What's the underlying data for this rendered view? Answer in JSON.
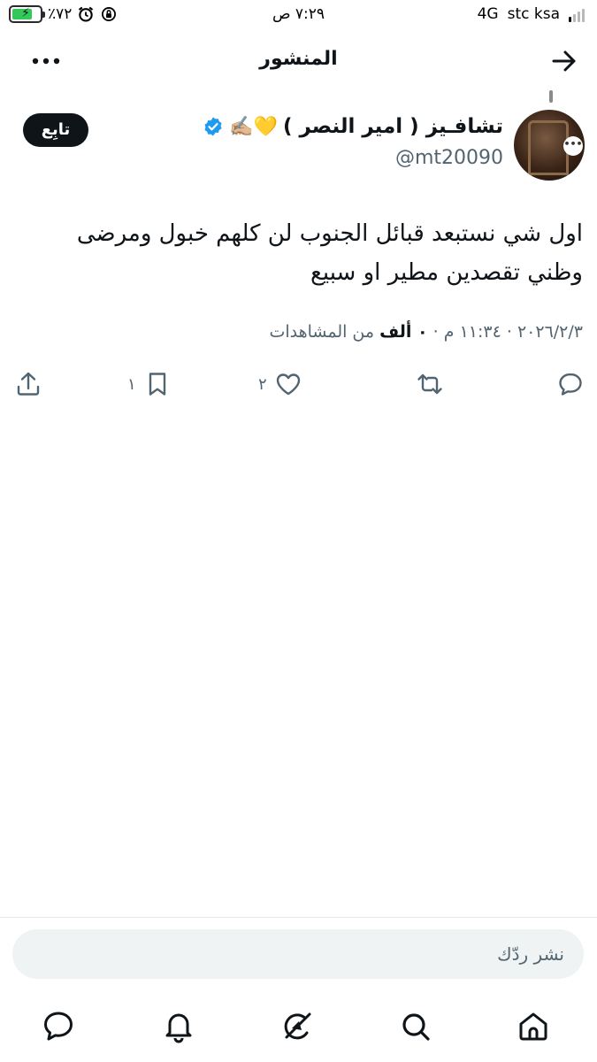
{
  "status_bar": {
    "battery_percent_text": "٪٧٢",
    "battery_level": 0.72,
    "time": "٧:٢٩ ص",
    "network": "4G",
    "carrier": "stc ksa",
    "icons": [
      "battery-charging-icon",
      "alarm-icon",
      "rotation-lock-icon",
      "signal-icon"
    ]
  },
  "header": {
    "title": "المنشور",
    "back_icon": "arrow-right-icon",
    "more_icon": "more-horizontal-icon"
  },
  "author": {
    "name": "تشافـيز ( امير النصر )",
    "emojis": "💛✍🏼",
    "verified": true,
    "handle": "@mt20090",
    "follow_label": "تابِع"
  },
  "tweet": {
    "text": "اول شي نستبعد قبائل الجنوب لن كلهم خبول ومرضى وظني تقصدين مطير او سبيع",
    "date": "٢٠٢٦/٢/٣",
    "time": "١١:٣٤ م",
    "separator": "·",
    "views_count": "٠ ألف",
    "views_label": "من المشاهدات"
  },
  "actions": {
    "reply": {
      "icon": "reply-icon",
      "count": ""
    },
    "retweet": {
      "icon": "retweet-icon",
      "count": ""
    },
    "like": {
      "icon": "heart-icon",
      "count": "٢"
    },
    "bookmark": {
      "icon": "bookmark-icon",
      "count": "١"
    },
    "share": {
      "icon": "share-icon",
      "count": ""
    }
  },
  "reply_box": {
    "placeholder": "نشر ردّك"
  },
  "bottom_nav": [
    {
      "name": "home",
      "icon": "home-icon"
    },
    {
      "name": "search",
      "icon": "search-icon"
    },
    {
      "name": "grok",
      "icon": "grok-icon"
    },
    {
      "name": "notifications",
      "icon": "bell-icon"
    },
    {
      "name": "messages",
      "icon": "message-icon"
    }
  ],
  "colors": {
    "text": "#0f1419",
    "secondary": "#536471",
    "verified": "#1d9bf0",
    "battery": "#34c759",
    "reply_bg": "#eff3f4"
  }
}
